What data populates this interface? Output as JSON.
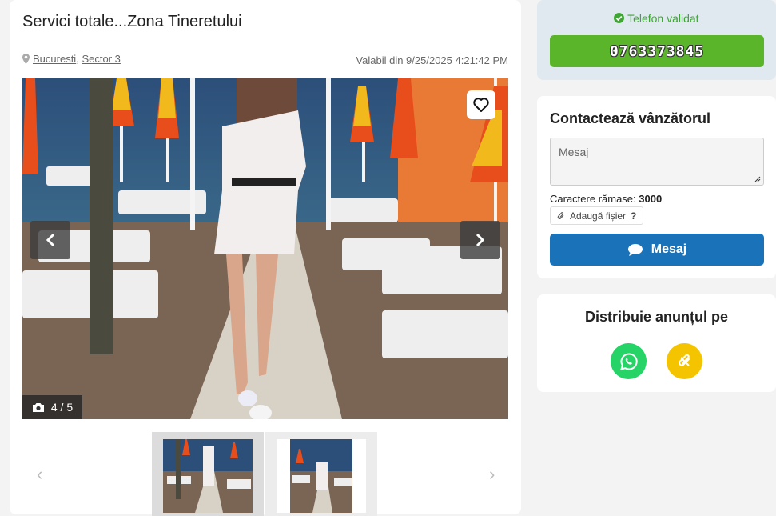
{
  "listing": {
    "title": "Servici totale...Zona Tineretului",
    "city": "Bucuresti",
    "sector": "Sector 3",
    "loc_sep": ",",
    "valid_from": "Valabil din 9/25/2025 4:21:42 PM"
  },
  "gallery": {
    "counter": "4 / 5",
    "current_index": 4,
    "total": 5
  },
  "seller": {
    "validated_label": "Telefon validat",
    "phone": "0763373845"
  },
  "contact": {
    "title": "Contactează vânzătorul",
    "message_placeholder": "Mesaj",
    "chars_label": "Caractere rămase:",
    "chars_value": "3000",
    "attach_label": "Adaugă fișier",
    "attach_help": "?",
    "send_label": "Mesaj"
  },
  "share": {
    "title": "Distribuie anunțul pe",
    "buttons": [
      {
        "name": "whatsapp",
        "color": "#25d366",
        "icon": "whatsapp-icon"
      },
      {
        "name": "copy-link",
        "color": "#f5c400",
        "icon": "paperclip-icon"
      }
    ]
  },
  "colors": {
    "phone_button": "#5bb52a",
    "send_button": "#1a72b8",
    "validated_text": "#3fa535"
  }
}
